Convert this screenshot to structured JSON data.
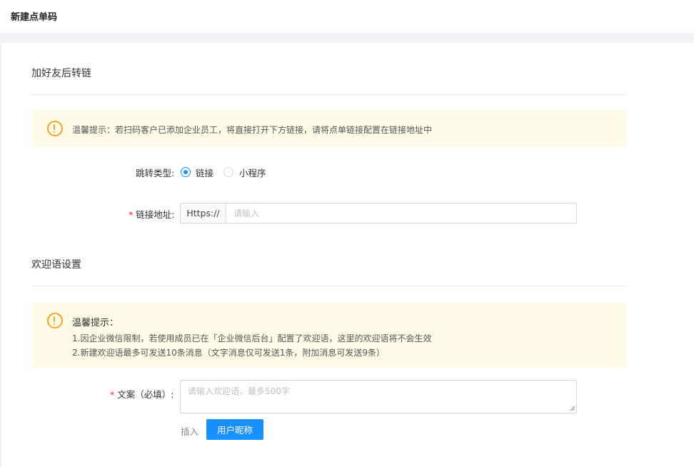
{
  "header": {
    "title": "新建点单码"
  },
  "section_redirect": {
    "title": "加好友后转链",
    "alert_text": "温馨提示：若扫码客户已添加企业员工，将直接打开下方链接，请将点单链接配置在链接地址中",
    "jump_type": {
      "label": "跳转类型:",
      "options": [
        {
          "label": "链接",
          "checked": true
        },
        {
          "label": "小程序",
          "checked": false
        }
      ]
    },
    "url": {
      "required_mark": "*",
      "label": "链接地址:",
      "prefix": "Https://",
      "value": "",
      "placeholder": "请输入"
    }
  },
  "section_welcome": {
    "title": "欢迎语设置",
    "alert": {
      "title": "温馨提示：",
      "lines": [
        "1.因企业微信限制，若使用成员已在「企业微信后台」配置了欢迎语，这里的欢迎语将不会生效",
        "2.新建欢迎语最多可发送10条消息（文字消息仅可发送1条，附加消息可发送9条）"
      ]
    },
    "copy": {
      "required_mark": "*",
      "label": "文案（必填）:",
      "value": "",
      "placeholder": "请输入欢迎语，最多500字"
    },
    "insert_label": "插入",
    "nickname_button": "用户昵称"
  },
  "colors": {
    "primary": "#1890ff",
    "warning": "#f5a623",
    "alert_bg": "#fffbe6",
    "required": "#f5222d"
  }
}
